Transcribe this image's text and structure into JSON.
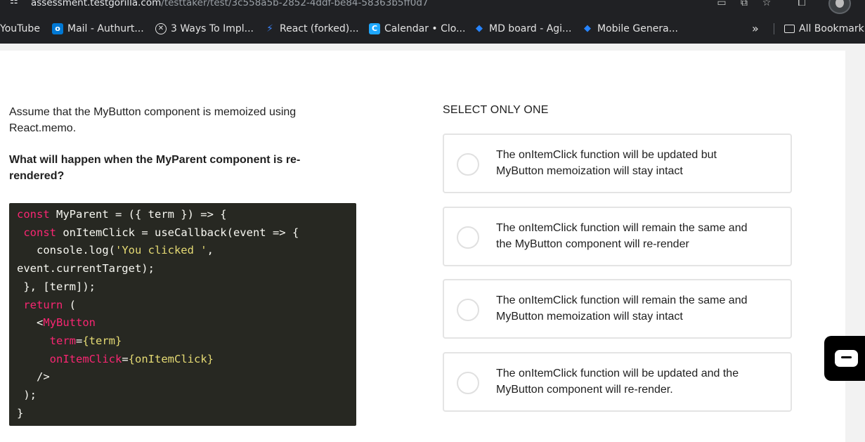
{
  "browser": {
    "url_host": "assessment.testgorilla.com",
    "url_path": "/testtaker/test/3c558a5b-2852-4ddf-be84-58363b5ff0d7",
    "bookmarks": [
      {
        "label": "YouTube",
        "icon": "youtube-icon"
      },
      {
        "label": "Mail - Authurt...",
        "icon": "outlook-icon",
        "color": "#0078d4"
      },
      {
        "label": "3 Ways To Impl...",
        "icon": "circle-x-icon"
      },
      {
        "label": "React (forked)...",
        "icon": "lightning-icon",
        "color": "#3b82f6"
      },
      {
        "label": "Calendar • Clo...",
        "icon": "calendar-icon",
        "color": "#1ea7fd"
      },
      {
        "label": "MD board - Agi...",
        "icon": "jira-icon",
        "color": "#2684ff"
      },
      {
        "label": "Mobile Genera...",
        "icon": "jira-icon",
        "color": "#2684ff"
      }
    ],
    "overflow": "»",
    "all_bookmarks": "All Bookmark"
  },
  "question": {
    "prompt": "Assume that the MyButton component is memoized using React.memo.",
    "question_text": "What will happen when the MyParent component is re-rendered?",
    "code_lines": [
      "const MyParent = ({ term }) => {",
      " const onItemClick = useCallback(event => {",
      "   console.log('You clicked ',",
      "event.currentTarget);",
      " }, [term]);",
      " return (",
      "   <MyButton",
      "     term={term}",
      "     onItemClick={onItemClick}",
      "   />",
      " );",
      "}"
    ]
  },
  "answers": {
    "select_label": "SELECT ONLY ONE",
    "options": [
      {
        "line1": "The onItemClick function will be updated but",
        "line2": "MyButton memoization will stay intact"
      },
      {
        "line1": "The onItemClick function will remain the same and",
        "line2": "the MyButton component will re-render"
      },
      {
        "line1": "The onItemClick function will remain the same and",
        "line2": "MyButton memoization will stay intact"
      },
      {
        "line1": "The onItemClick function will be updated and the",
        "line2": "MyButton component will re-render."
      }
    ]
  },
  "chat": {
    "icon": "chat-icon"
  }
}
